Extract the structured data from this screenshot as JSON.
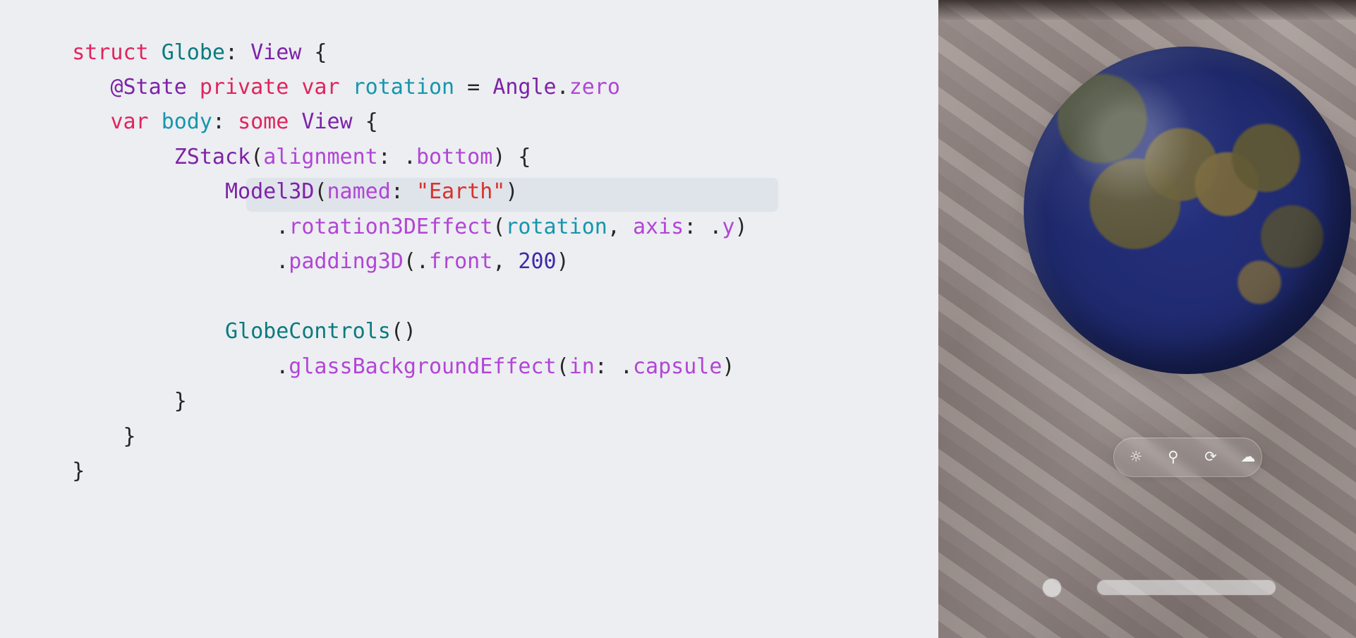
{
  "code": {
    "line_1": {
      "kw_struct": "struct",
      "sp_1": " ",
      "type_globe": "Globe",
      "colon_1": ": ",
      "type_view": "View",
      "brace_open": " {"
    },
    "line_2": {
      "indent": "   ",
      "attr_state": "@State",
      "sp_1": " ",
      "kw_private": "private",
      "sp_2": " ",
      "kw_var": "var",
      "sp_3": " ",
      "var_rotation": "rotation",
      "eq": " = ",
      "type_angle": "Angle",
      "dot": ".",
      "member_zero": "zero"
    },
    "line_3": {
      "indent": "   ",
      "kw_var": "var",
      "sp_1": " ",
      "var_body": "body",
      "colon": ": ",
      "kw_some": "some",
      "sp_2": " ",
      "type_view": "View",
      "brace_open": " {"
    },
    "line_4": {
      "indent": "        ",
      "type_zstack": "ZStack",
      "paren_open": "(",
      "label_alignment": "alignment",
      "colon": ": ",
      "dot": ".",
      "member_bottom": "bottom",
      "paren_close": ") {"
    },
    "line_5": {
      "indent": "            ",
      "type_model3d": "Model3D",
      "paren_open": "(",
      "label_named": "named",
      "colon": ": ",
      "string_earth": "\"Earth\"",
      "paren_close": ")"
    },
    "line_6": {
      "indent": "                ",
      "dot": ".",
      "method_rotation3d": "rotation3DEffect",
      "paren_open": "(",
      "var_rotation": "rotation",
      "comma": ", ",
      "label_axis": "axis",
      "colon": ": ",
      "dot_2": ".",
      "member_y": "y",
      "paren_close": ")"
    },
    "line_7": {
      "indent": "                ",
      "dot": ".",
      "method_padding3d": "padding3D",
      "paren_open": "(",
      "dot_2": ".",
      "member_front": "front",
      "comma": ", ",
      "number_200": "200",
      "paren_close": ")"
    },
    "line_8": {
      "blank": ""
    },
    "line_9": {
      "indent": "            ",
      "type_globecontrols": "GlobeControls",
      "paren": "()"
    },
    "line_10": {
      "indent": "                ",
      "dot": ".",
      "method_glass": "glassBackgroundEffect",
      "paren_open": "(",
      "label_in": "in",
      "colon": ": ",
      "dot_2": ".",
      "member_capsule": "capsule",
      "paren_close": ")"
    },
    "line_11": {
      "indent": "        ",
      "brace_close": "}"
    },
    "line_12": {
      "indent": "    ",
      "brace_close": "}"
    },
    "line_13": {
      "brace_close": "}"
    }
  },
  "preview": {
    "controls": {
      "light_icon": "☼",
      "location_icon": "⚲",
      "rotate_icon": "⟳",
      "weather_icon": "☁"
    }
  }
}
